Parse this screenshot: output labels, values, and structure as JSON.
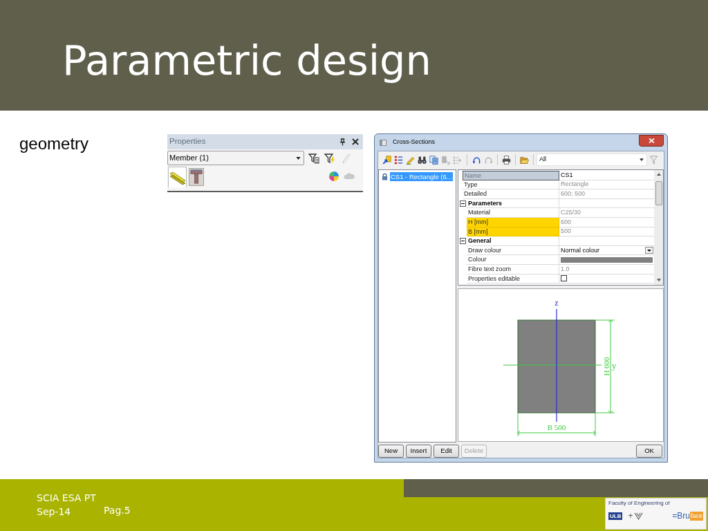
{
  "slide": {
    "title": "Parametric design",
    "subtitle": "geometry"
  },
  "properties_panel": {
    "title": "Properties",
    "selector": {
      "value": "Member (1)"
    },
    "tools": [
      {
        "kind": "filter-list",
        "disabled": false
      },
      {
        "kind": "filter-flash",
        "disabled": false
      },
      {
        "kind": "pencil",
        "disabled": true
      }
    ],
    "tabs": [
      {
        "kind": "beam",
        "selected": true
      },
      {
        "kind": "section",
        "selected": false
      }
    ],
    "actions": [
      {
        "kind": "pie",
        "disabled": false
      },
      {
        "kind": "cloud",
        "disabled": true
      }
    ]
  },
  "cross_sections": {
    "title": "Cross-Sections",
    "toolbar": [
      [
        {
          "kind": "new",
          "disabled": false
        },
        {
          "kind": "arrange",
          "disabled": false
        },
        {
          "kind": "edit",
          "disabled": false
        },
        {
          "kind": "find",
          "disabled": false
        },
        {
          "kind": "copy",
          "disabled": false
        },
        {
          "kind": "move",
          "disabled": true
        },
        {
          "kind": "insert",
          "disabled": true
        }
      ],
      [
        {
          "kind": "undo",
          "disabled": false
        },
        {
          "kind": "redo",
          "disabled": true
        }
      ],
      [
        {
          "kind": "print",
          "disabled": false
        }
      ],
      [
        {
          "kind": "open",
          "disabled": false
        }
      ]
    ],
    "filter": {
      "value": "All"
    },
    "tree": [
      {
        "label": "CS1 - Rectangle (6...",
        "selected": true
      }
    ],
    "properties": [
      {
        "kind": "text",
        "name": "Name",
        "value": "CS1",
        "selected": true,
        "highlighted": false,
        "readonly": false
      },
      {
        "kind": "text",
        "name": "Type",
        "value": "Rectangle",
        "selected": false,
        "highlighted": false,
        "readonly": true
      },
      {
        "kind": "text",
        "name": "Detailed",
        "value": "600; 500",
        "selected": false,
        "highlighted": false,
        "readonly": true
      },
      {
        "kind": "group",
        "name": "Parameters",
        "expanded": true,
        "children": [
          {
            "kind": "text",
            "name": "Material",
            "value": "C25/30",
            "selected": false,
            "highlighted": false,
            "readonly": true
          },
          {
            "kind": "text",
            "name": "H [mm]",
            "value": "600",
            "selected": false,
            "highlighted": true,
            "readonly": true
          },
          {
            "kind": "text",
            "name": "B [mm]",
            "value": "500",
            "selected": false,
            "highlighted": true,
            "readonly": true
          }
        ]
      },
      {
        "kind": "group",
        "name": "General",
        "expanded": true,
        "children": [
          {
            "kind": "dropdown",
            "name": "Draw colour",
            "value": "Normal colour",
            "selected": false,
            "highlighted": false,
            "readonly": false
          },
          {
            "kind": "swatch",
            "name": "Colour",
            "selected": false,
            "highlighted": false
          },
          {
            "kind": "text",
            "name": "Fibre text zoom",
            "value": "1.0",
            "selected": false,
            "highlighted": false,
            "readonly": true
          },
          {
            "kind": "checkbox",
            "name": "Properties editable",
            "checked": false,
            "selected": false,
            "highlighted": false
          }
        ]
      }
    ],
    "section_view": {
      "z_label": "z",
      "y_label": "y",
      "height_dimension": "H 600",
      "width_dimension": "B 500"
    },
    "buttons": [
      {
        "label": "New",
        "disabled": false
      },
      {
        "label": "Insert",
        "disabled": false
      },
      {
        "label": "Edit",
        "disabled": false
      },
      {
        "label": "Delete",
        "disabled": true
      }
    ],
    "ok_button": {
      "label": "OK"
    }
  },
  "footer": {
    "lines": [
      "SCIA ESA PT",
      "Sep-14"
    ],
    "page": "Pag.5",
    "logo": {
      "caption": "Faculty of Engineering of",
      "badge": "ULB",
      "plus": "+",
      "brand": "=Bru",
      "brand_tile": "face"
    }
  }
}
